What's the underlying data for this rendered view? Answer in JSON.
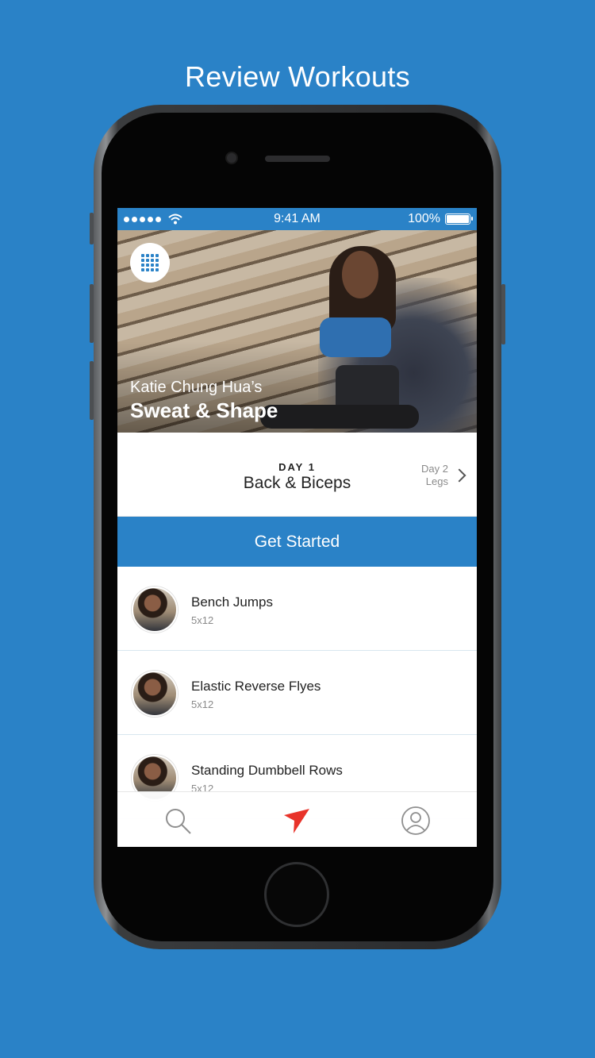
{
  "headline": "Review Workouts",
  "status_bar": {
    "time": "9:41 AM",
    "battery": "100%",
    "battery_level": 1.0
  },
  "hero": {
    "subtitle": "Katie Chung Hua’s",
    "title": "Sweat & Shape",
    "menu_icon": "grid-icon"
  },
  "day": {
    "label": "DAY 1",
    "name": "Back & Biceps",
    "next_label": "Day 2",
    "next_name": "Legs"
  },
  "cta_label": "Get Started",
  "exercises": [
    {
      "name": "Bench Jumps",
      "reps": "5x12"
    },
    {
      "name": "Elastic Reverse Flyes",
      "reps": "5x12"
    },
    {
      "name": "Standing Dumbbell Rows",
      "reps": "5x12"
    }
  ],
  "tabbar": {
    "items": [
      {
        "icon": "search-icon"
      },
      {
        "icon": "paper-plane-icon"
      },
      {
        "icon": "profile-icon"
      }
    ]
  },
  "colors": {
    "background": "#2a82c7",
    "accent": "#2a82c7",
    "active_tab": "#e8332a"
  }
}
